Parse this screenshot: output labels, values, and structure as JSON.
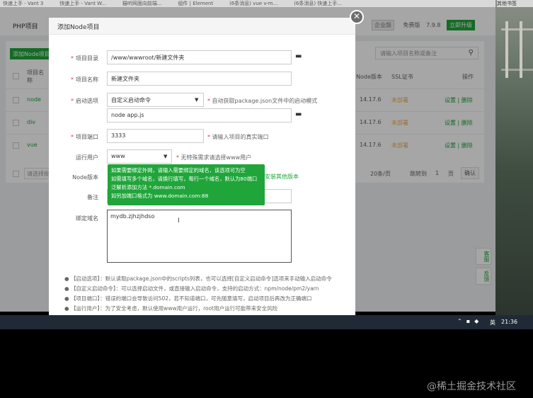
{
  "browser": {
    "tabs": [
      "快速上手 - Vant 3",
      "快速上手 - Vant W...",
      "猫听网面向前端...",
      "组件 | Element",
      "(6条消息) vue v-m...",
      "(6条消息) 快速上手..."
    ],
    "right_label": "其他书签"
  },
  "app": {
    "page_title": "PHP项目",
    "header": {
      "enterprise_badge": "企业版",
      "free_label": "免费版",
      "version": "7.9.8",
      "upgrade_label": "立即升级"
    },
    "add_button": "添加Node项目",
    "search_placeholder": "请输入项目名称或备注",
    "table_headers": {
      "name": "项目名称",
      "node_version": "Node版本",
      "ssl": "SSL证书",
      "ops": "操作"
    },
    "rows": [
      {
        "name": "node",
        "version": "14.17.6",
        "ssl": "未部署",
        "ops": "设置 | 删除"
      },
      {
        "name": "div",
        "version": "14.17.6",
        "ssl": "未部署",
        "ops": "设置 | 删除"
      },
      {
        "name": "vue",
        "version": "14.17.6",
        "ssl": "未部署",
        "ops": "设置 | 删除"
      }
    ],
    "pager": {
      "bulk_placeholder": "请选择批",
      "per_page": "20条/页",
      "jump_label": "跳转到",
      "page": "1",
      "page_unit": "页",
      "confirm": "确认"
    },
    "side_tools": [
      "客服",
      "反馈"
    ]
  },
  "modal": {
    "title": "添加Node项目",
    "close_glyph": "✕",
    "fields": {
      "dir_label": "项目目录",
      "dir_value": "/www/wwwroot/新建文件夹",
      "name_label": "项目名称",
      "name_value": "新建文件夹",
      "start_label": "启动选项",
      "start_value": "自定义启动命令",
      "start_hint": "自动获取package.json文件中的启动模式",
      "command_value": "node app.js",
      "port_label": "项目端口",
      "port_value": "3333",
      "port_hint": "请输入项目的真实端口",
      "user_label": "运行用户",
      "user_value": "www",
      "user_hint": "无特殊需求请选择www用户",
      "node_label": "Node版本",
      "node_link": "安装其他版本",
      "remark_label": "备注",
      "domain_label": "绑定域名",
      "domain_value": "mydb.zjhzjhdso"
    },
    "tooltip_lines": [
      "如果需要绑定外网，请输入需要绑定的域名，该选项可为空",
      "如需填写多个域名，请换行填写，每行一个域名，默认为80端口",
      "泛解析添加方法 *.domain.com",
      "如另加端口格式为 www.domain.com:88"
    ],
    "notes": [
      "【启动选项】：默认读取package.json中的scripts列表，也可以选择[自定义启动命令]选项来手动输入启动命令",
      "【自定义启动命令】：可以选择启动文件，或直接输入启动命令，支持的启动方式：npm/node/pm2/yarn",
      "【项目端口】：错误的端口会导致访问502，若不知道端口，可先随意填写，启动项目后再改为正确端口",
      "【运行用户】：为了安全考虑，默认使用www用户运行，root用户运行可能带来安全风险"
    ]
  },
  "taskbar": {
    "ime": "英",
    "time": "21:36"
  },
  "watermark": "@稀土掘金技术社区"
}
